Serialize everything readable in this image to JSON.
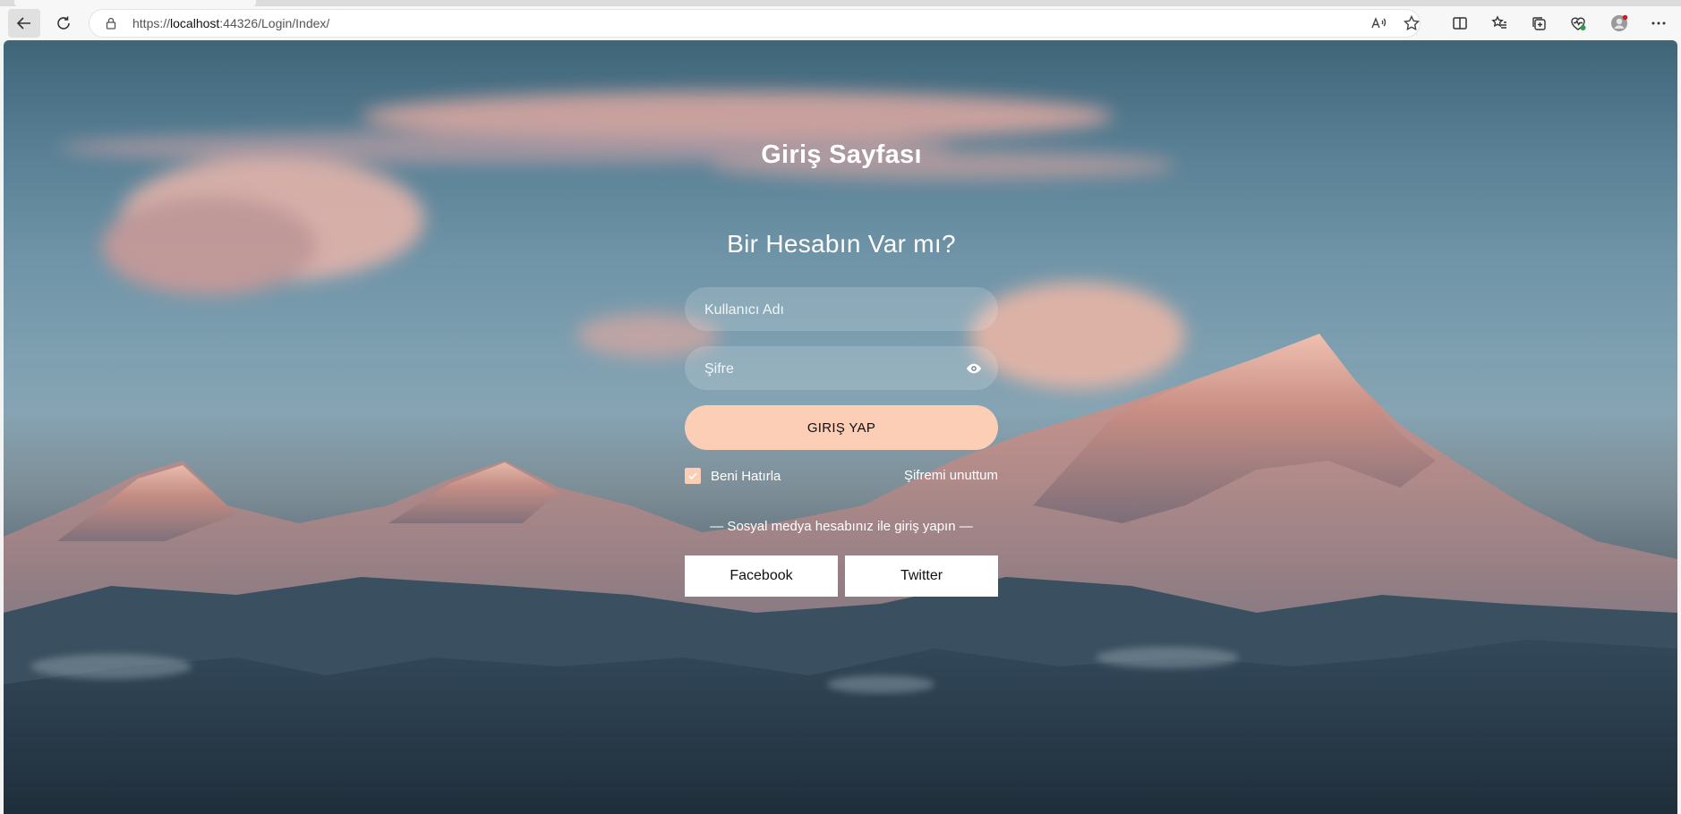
{
  "browser": {
    "url_scheme": "https://",
    "url_host": "localhost",
    "url_rest": ":44326/Login/Index/",
    "toolbar_icons": [
      "back-icon",
      "refresh-icon",
      "lock-icon",
      "read-aloud-icon",
      "favorite-star-icon",
      "split-screen-icon",
      "favorites-icon",
      "collections-icon",
      "browser-essentials-icon",
      "profile-icon",
      "more-icon"
    ]
  },
  "login": {
    "title": "Giriş Sayfası",
    "subtitle": "Bir Hesabın Var mı?",
    "username_placeholder": "Kullanıcı Adı",
    "password_placeholder": "Şifre",
    "submit_label": "GIRIŞ YAP",
    "remember_label": "Beni Hatırla",
    "remember_checked": true,
    "forgot_label": "Şifremi unuttum",
    "social_label": "— Sosyal medya hesabınız ile giriş yapın —",
    "facebook_label": "Facebook",
    "twitter_label": "Twitter"
  },
  "colors": {
    "accent": "#fbceb5",
    "browser_chrome": "#f7f7f7"
  }
}
